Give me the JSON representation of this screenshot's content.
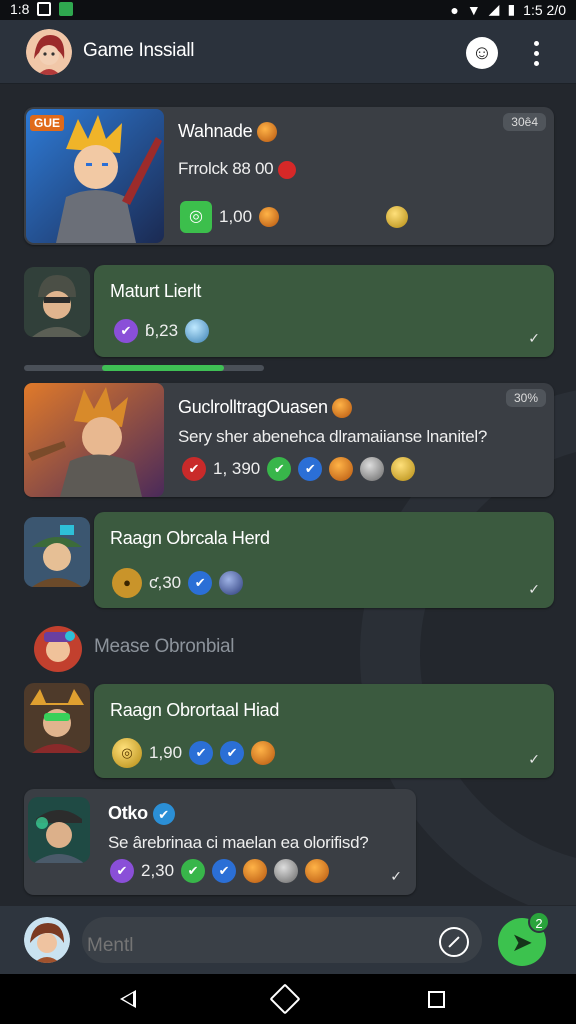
{
  "status_bar": {
    "time_left": "1:8",
    "time_right": "1:5 2/0"
  },
  "header": {
    "title": "Game Inssiall",
    "emoji": "☺"
  },
  "messages": [
    {
      "title": "Wahnade",
      "subtitle": "Frrolck 88 00",
      "value": "1,00",
      "badge": "30ê4",
      "art_badge": "GUE"
    },
    {
      "title": "Maturt Lierlt",
      "value": "ɓ,23"
    },
    {
      "title": "GuclrolltragOuasen",
      "subtitle": "Sery sher abenehca dlramaiianse lnanitel?",
      "value": "1, 390",
      "badge": "30%"
    },
    {
      "title": "Raagn Obrcala Herd",
      "value": "ƈ,30"
    },
    {
      "title": "Raagn Obrortaal Hiad",
      "value": "1,90"
    },
    {
      "title": "Otko",
      "subtitle": "Se ârebrinaa ci maelan ea olorifisd?",
      "value": "2,30"
    }
  ],
  "divider": {
    "label": "Mease Obronbial"
  },
  "progress": {
    "value": 0.55
  },
  "composer": {
    "placeholder": "Mentl",
    "unread": "2"
  },
  "colors": {
    "accent_green": "#3cc24e",
    "bubble_green": "#3b5a3f",
    "bubble_dark": "#3a3e44"
  }
}
